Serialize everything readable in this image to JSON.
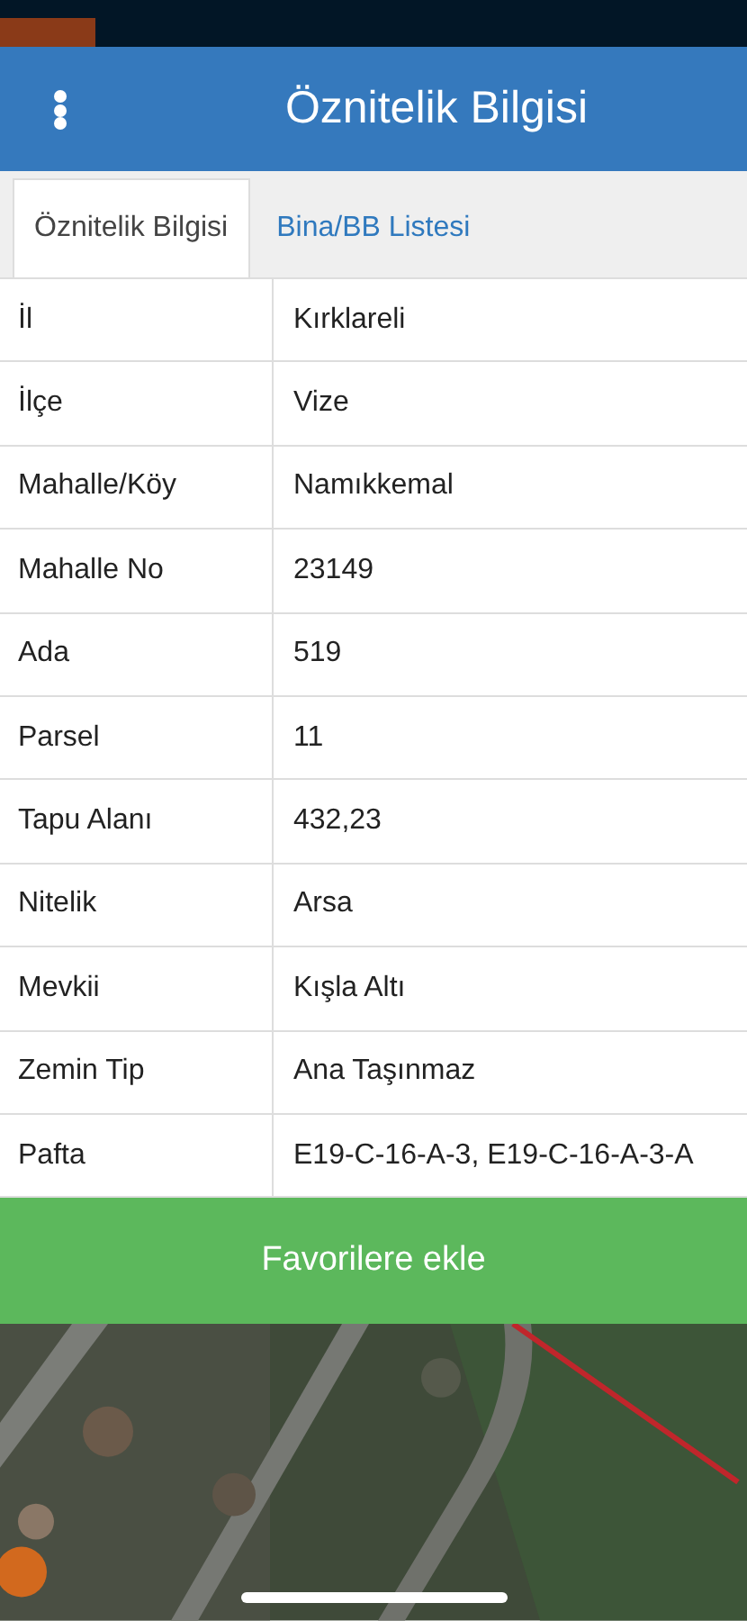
{
  "header": {
    "title": "Öznitelik Bilgisi"
  },
  "tabs": [
    {
      "label": "Öznitelik Bilgisi",
      "selected": true
    },
    {
      "label": "Bina/BB Listesi",
      "selected": false
    }
  ],
  "rows": [
    {
      "label": "İl",
      "value": "Kırklareli"
    },
    {
      "label": "İlçe",
      "value": "Vize"
    },
    {
      "label": "Mahalle/Köy",
      "value": "Namıkkemal"
    },
    {
      "label": "Mahalle No",
      "value": "23149"
    },
    {
      "label": "Ada",
      "value": "519"
    },
    {
      "label": "Parsel",
      "value": "11"
    },
    {
      "label": "Tapu Alanı",
      "value": "432,23"
    },
    {
      "label": "Nitelik",
      "value": "Arsa"
    },
    {
      "label": "Mevkii",
      "value": "Kışla Altı"
    },
    {
      "label": "Zemin Tip",
      "value": "Ana Taşınmaz"
    },
    {
      "label": "Pafta",
      "value": "E19-C-16-A-3, E19-C-16-A-3-A"
    }
  ],
  "button": {
    "label": "Favorilere ekle"
  }
}
